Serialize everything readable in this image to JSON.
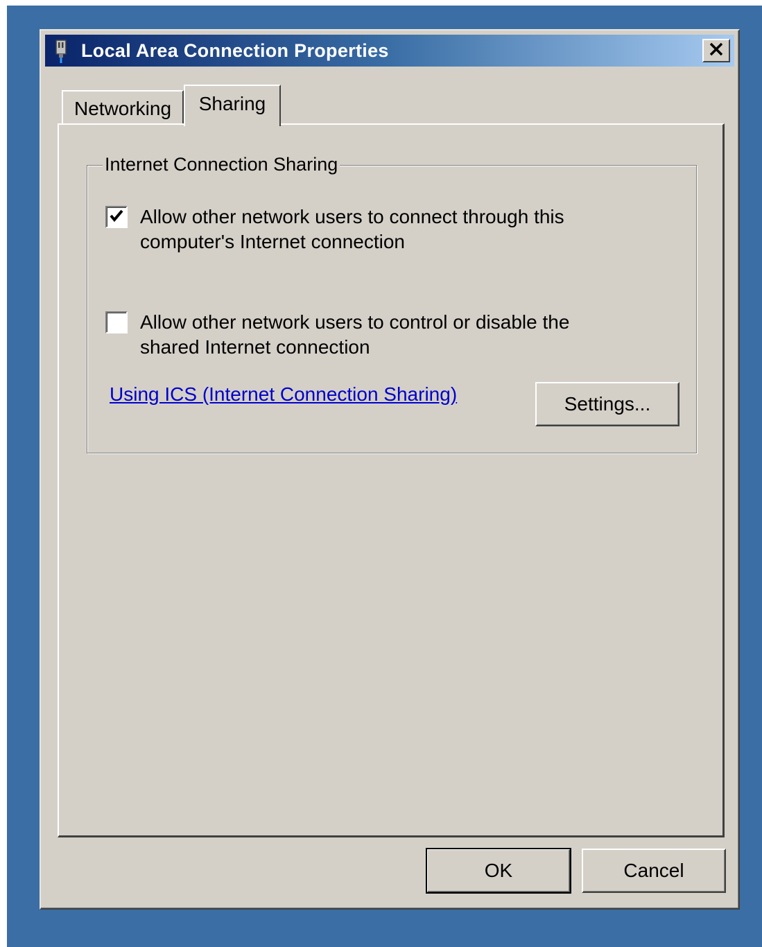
{
  "window": {
    "title": "Local Area Connection Properties",
    "title_icon": "network-adapter-icon",
    "close_icon": "close-icon"
  },
  "tabs": [
    {
      "label": "Networking",
      "active": false
    },
    {
      "label": "Sharing",
      "active": true
    }
  ],
  "ics_group": {
    "legend": "Internet Connection Sharing",
    "allow_connect": {
      "label": "Allow other network users to connect through this computer's Internet connection",
      "checked": true
    },
    "allow_control": {
      "label": "Allow other network users to control or disable the shared Internet connection",
      "checked": false
    },
    "help_link": "Using ICS (Internet Connection Sharing)",
    "settings_label": "Settings..."
  },
  "buttons": {
    "ok_label": "OK",
    "cancel_label": "Cancel"
  },
  "colors": {
    "desktop": "#3a6ea5",
    "titlebar_start": "#0a246a",
    "titlebar_end": "#a6caf0",
    "face": "#d4d0c8",
    "link": "#0000cc"
  }
}
